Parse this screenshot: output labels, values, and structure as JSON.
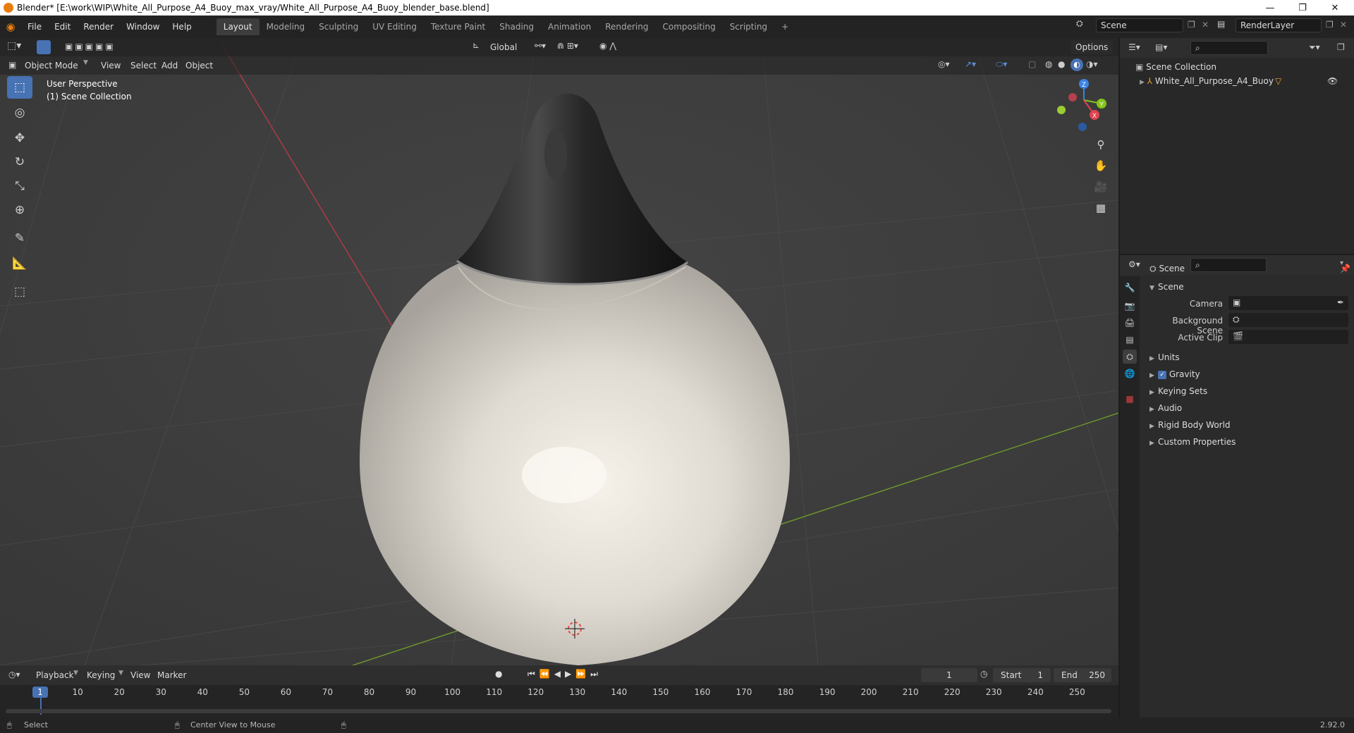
{
  "window": {
    "title": "Blender* [E:\\work\\WIP\\White_All_Purpose_A4_Buoy_max_vray/White_All_Purpose_A4_Buoy_blender_base.blend]",
    "controls": [
      "—",
      "❐",
      "✕"
    ]
  },
  "menu": [
    "File",
    "Edit",
    "Render",
    "Window",
    "Help"
  ],
  "workspaces": [
    "Layout",
    "Modeling",
    "Sculpting",
    "UV Editing",
    "Texture Paint",
    "Shading",
    "Animation",
    "Rendering",
    "Compositing",
    "Scripting",
    "+"
  ],
  "scene_field": "Scene",
  "renderlayer_field": "RenderLayer",
  "viewport": {
    "transform_orientation": "Global",
    "options_label": "Options",
    "mode": "Object Mode",
    "header_menus": [
      "View",
      "Select",
      "Add",
      "Object"
    ],
    "overlay_text": [
      "User Perspective",
      "(1) Scene Collection"
    ],
    "gizmo_axes": {
      "x": "X",
      "y": "Y",
      "z": "Z"
    }
  },
  "outliner": {
    "root": "Scene Collection",
    "items": [
      {
        "label": "White_All_Purpose_A4_Buoy"
      }
    ]
  },
  "properties": {
    "context_title": "Scene",
    "section": "Scene",
    "fields": [
      {
        "label": "Camera",
        "value": ""
      },
      {
        "label": "Background Scene",
        "value": ""
      },
      {
        "label": "Active Clip",
        "value": ""
      }
    ],
    "subpanels": [
      "Units",
      "Gravity",
      "Keying Sets",
      "Audio",
      "Rigid Body World",
      "Custom Properties"
    ],
    "gravity_checked": true
  },
  "timeline": {
    "menus": [
      "Playback",
      "Keying",
      "View",
      "Marker"
    ],
    "current_frame": "1",
    "start_label": "Start",
    "start_value": "1",
    "end_label": "End",
    "end_value": "250",
    "ruler_marks": [
      "1",
      "10",
      "20",
      "30",
      "40",
      "50",
      "60",
      "70",
      "80",
      "90",
      "100",
      "110",
      "120",
      "130",
      "140",
      "150",
      "160",
      "170",
      "180",
      "190",
      "200",
      "210",
      "220",
      "230",
      "240",
      "250"
    ]
  },
  "statusbar": {
    "left_action": "Select",
    "middle_action": "Center View to Mouse",
    "version": "2.92.0"
  },
  "colors": {
    "accent": "#4772b3",
    "x_axis": "#e0434f",
    "y_axis": "#84c41b",
    "z_axis": "#3b83e6",
    "viewport_bg": "#3b3b3b"
  }
}
